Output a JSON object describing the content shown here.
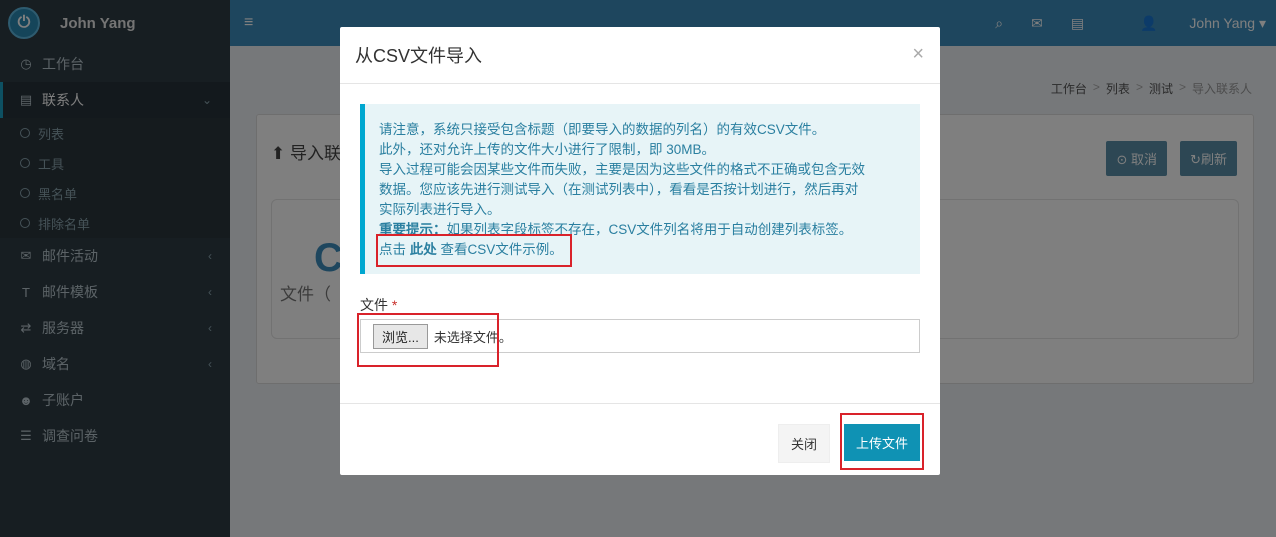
{
  "brand": {
    "name": "John Yang",
    "logo": "power-icon"
  },
  "sidebar": {
    "items": [
      {
        "label": "工作台",
        "icon": "dashboard-icon"
      },
      {
        "label": "联系人",
        "icon": "list-icon",
        "active": true,
        "children": [
          "列表",
          "工具",
          "黑名单",
          "排除名单"
        ]
      },
      {
        "label": "邮件活动",
        "icon": "envelope-icon"
      },
      {
        "label": "邮件模板",
        "icon": "text-icon"
      },
      {
        "label": "服务器",
        "icon": "exchange-icon"
      },
      {
        "label": "域名",
        "icon": "globe-icon"
      },
      {
        "label": "子账户",
        "icon": "users-icon"
      },
      {
        "label": "调查问卷",
        "icon": "list-ul-icon"
      }
    ]
  },
  "header": {
    "user": "John Yang"
  },
  "breadcrumb": [
    "工作台",
    "列表",
    "测试",
    "导入联系人"
  ],
  "page": {
    "title": "导入联",
    "cancel": "取消",
    "refresh": "刷新",
    "big_letter": "C",
    "file_hint": "文件（"
  },
  "modal": {
    "title": "从CSV文件导入",
    "close_symbol": "×",
    "notice": {
      "line1": "请注意，系统只接受包含标题（即要导入的数据的列名）的有效CSV文件。",
      "line2": "此外，还对允许上传的文件大小进行了限制，即 30MB。",
      "line3": "导入过程可能会因某些文件而失败，主要是因为这些文件的格式不正确或包含无效",
      "line4": "数据。您应该先进行测试导入（在测试列表中），看看是否按计划进行，然后再对",
      "line5": "实际列表进行导入。",
      "important_label": "重要提示：",
      "important_text": "如果列表字段标签不存在，CSV文件列名将用于自动创建列表标签。",
      "link_prefix": "点击 ",
      "link_text": "此处",
      "link_suffix": " 查看CSV文件示例。"
    },
    "file_label": "文件",
    "required_mark": "*",
    "browse_label": "浏览...",
    "no_file_text": "未选择文件。",
    "close_button": "关闭",
    "upload_button": "上传文件"
  },
  "colors": {
    "accent": "#3c8dbc",
    "upload": "#0f92b4",
    "highlight": "#d9222a"
  }
}
